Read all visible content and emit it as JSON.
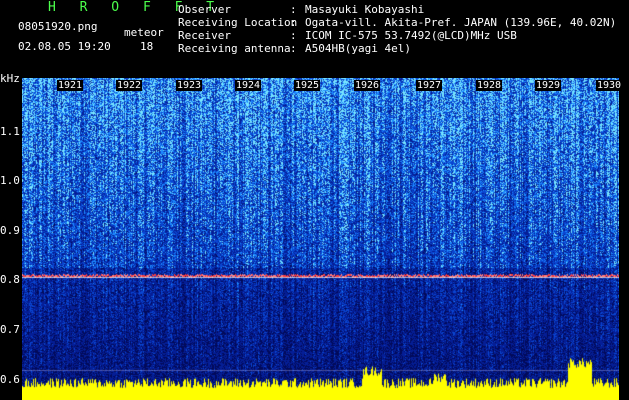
{
  "header": {
    "app_title": "H R O F F T",
    "filename": "08051920.png",
    "meteor_label": "meteor",
    "datetime": "02.08.05 19:20",
    "meteor_count": "18",
    "fields": [
      {
        "label": "Observer",
        "value": "Masayuki Kobayashi"
      },
      {
        "label": "Receiving Location",
        "value": "Ogata-vill. Akita-Pref. JAPAN (139.96E, 40.02N)"
      },
      {
        "label": "Receiver",
        "value": "ICOM IC-575 53.7492(@LCD)MHz USB"
      },
      {
        "label": "Receiving antenna",
        "value": "A504HB(yagi 4el)"
      }
    ]
  },
  "axis": {
    "unit": "kHz",
    "y_labels": [
      "1.1",
      "1.0",
      "0.9",
      "0.8",
      "0.7",
      "0.6"
    ],
    "time_labels": [
      "1921",
      "1922",
      "1923",
      "1924",
      "1925",
      "1926",
      "1927",
      "1928",
      "1929",
      "1930"
    ]
  },
  "colors": {
    "title": "#4cff4c",
    "spectrogram_low": "#001a66",
    "spectrogram_high": "#3fa7ff",
    "signal": "#ff3b3b",
    "level_bar": "#ffff00"
  }
}
